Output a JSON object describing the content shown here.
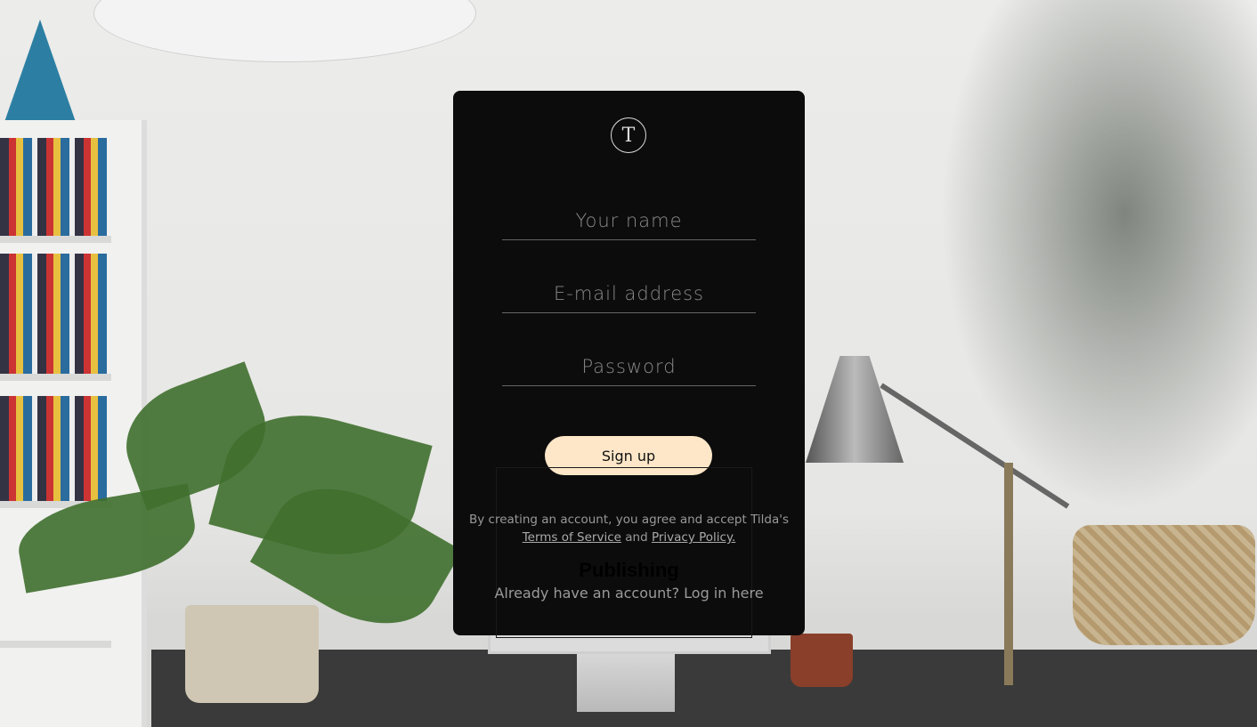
{
  "logo_letter": "T",
  "form": {
    "name_placeholder": "Your name",
    "email_placeholder": "E-mail address",
    "password_placeholder": "Password",
    "signup_label": "Sign up",
    "terms_prefix": "By creating an account, you agree and accept Tilda's",
    "terms_link": "Terms of Service",
    "terms_and": "and",
    "privacy_link": "Privacy Policy.",
    "login_link": "Already have an account? Log in here"
  },
  "background": {
    "monitor_text": "Publishing"
  },
  "colors": {
    "panel": "#0c0c0d",
    "button": "#fde7c8"
  }
}
